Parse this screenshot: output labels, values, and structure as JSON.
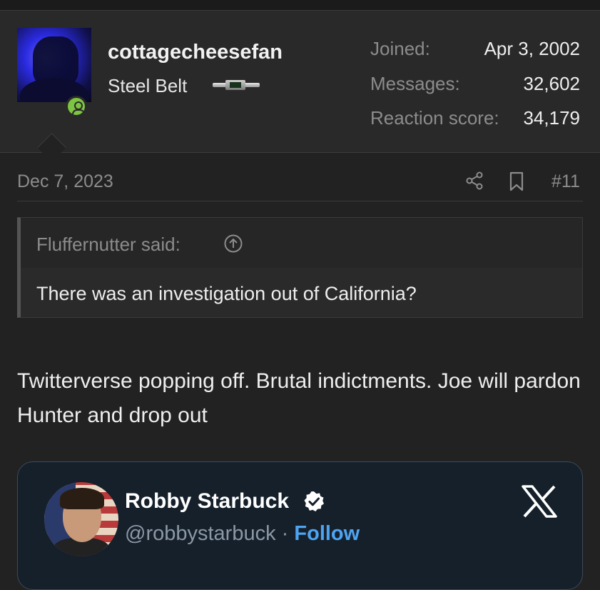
{
  "user": {
    "username": "cottagecheesefan",
    "title": "Steel Belt",
    "stats": [
      {
        "label": "Joined:",
        "value": "Apr 3, 2002"
      },
      {
        "label": "Messages:",
        "value": "32,602"
      },
      {
        "label": "Reaction score:",
        "value": "34,179"
      }
    ]
  },
  "post": {
    "date": "Dec 7, 2023",
    "number": "#11",
    "quote": {
      "author": "Fluffernutter said:",
      "text": "There was an investigation out of California?"
    },
    "message": "Twitterverse popping off. Brutal indictments. Joe will pardon Hunter and drop out"
  },
  "embed": {
    "name": "Robby Starbuck",
    "handle": "@robbystarbuck",
    "separator": "·",
    "follow": "Follow"
  },
  "colors": {
    "background": "#222222",
    "online": "#7cc442",
    "embed_bg": "#15202b",
    "follow": "#4ea4f0"
  },
  "icons": [
    "share-icon",
    "bookmark-icon",
    "arrow-up-circle-icon",
    "verified-badge-icon",
    "x-logo-icon",
    "online-status-icon"
  ]
}
